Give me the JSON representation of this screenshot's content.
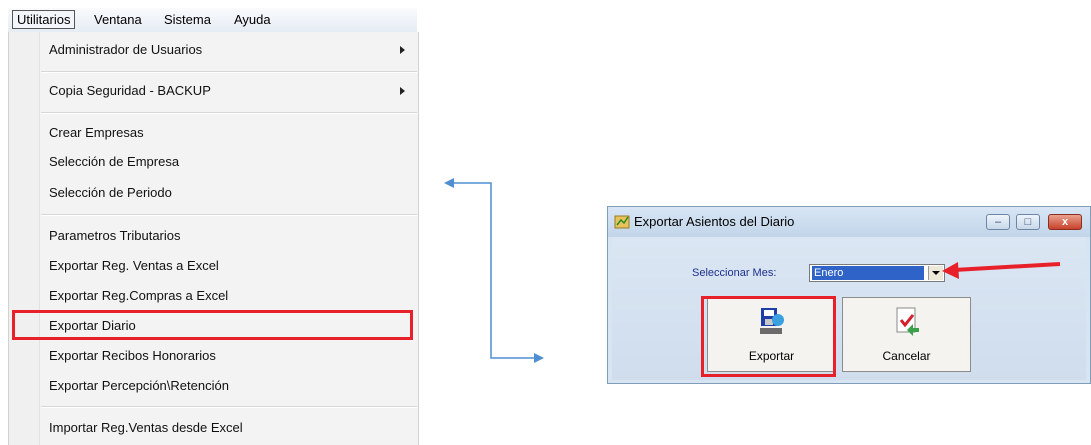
{
  "menubar": {
    "items": [
      "Utilitarios",
      "Ventana",
      "Sistema",
      "Ayuda"
    ]
  },
  "menu": {
    "items": [
      {
        "label": "Administrador de Usuarios",
        "submenu": true
      },
      {
        "label": "Copia Seguridad - BACKUP",
        "submenu": true
      },
      {
        "label": "Crear Empresas"
      },
      {
        "label": "Selección de Empresa"
      },
      {
        "label": "Selección de Periodo"
      },
      {
        "label": "Parametros Tributarios"
      },
      {
        "label": "Exportar Reg. Ventas a Excel"
      },
      {
        "label": "Exportar Reg.Compras a Excel"
      },
      {
        "label": "Exportar Diario",
        "highlighted": true
      },
      {
        "label": "Exportar Recibos Honorarios"
      },
      {
        "label": "Exportar Percepción\\Retención"
      },
      {
        "label": "Importar Reg.Ventas desde Excel"
      }
    ]
  },
  "dialog": {
    "title": "Exportar Asientos del Diario",
    "mes_label": "Seleccionar Mes:",
    "mes_value": "Enero",
    "export_label": "Exportar",
    "cancel_label": "Cancelar",
    "window_buttons": [
      "minimize",
      "maximize",
      "close"
    ]
  },
  "colors": {
    "highlight_red": "#e8202a",
    "connector_blue": "#4f8fd1",
    "dialog_bg": "#d7e4f2"
  },
  "icons": [
    "chevron-right-icon",
    "export-icon",
    "cancel-icon",
    "app-icon"
  ]
}
